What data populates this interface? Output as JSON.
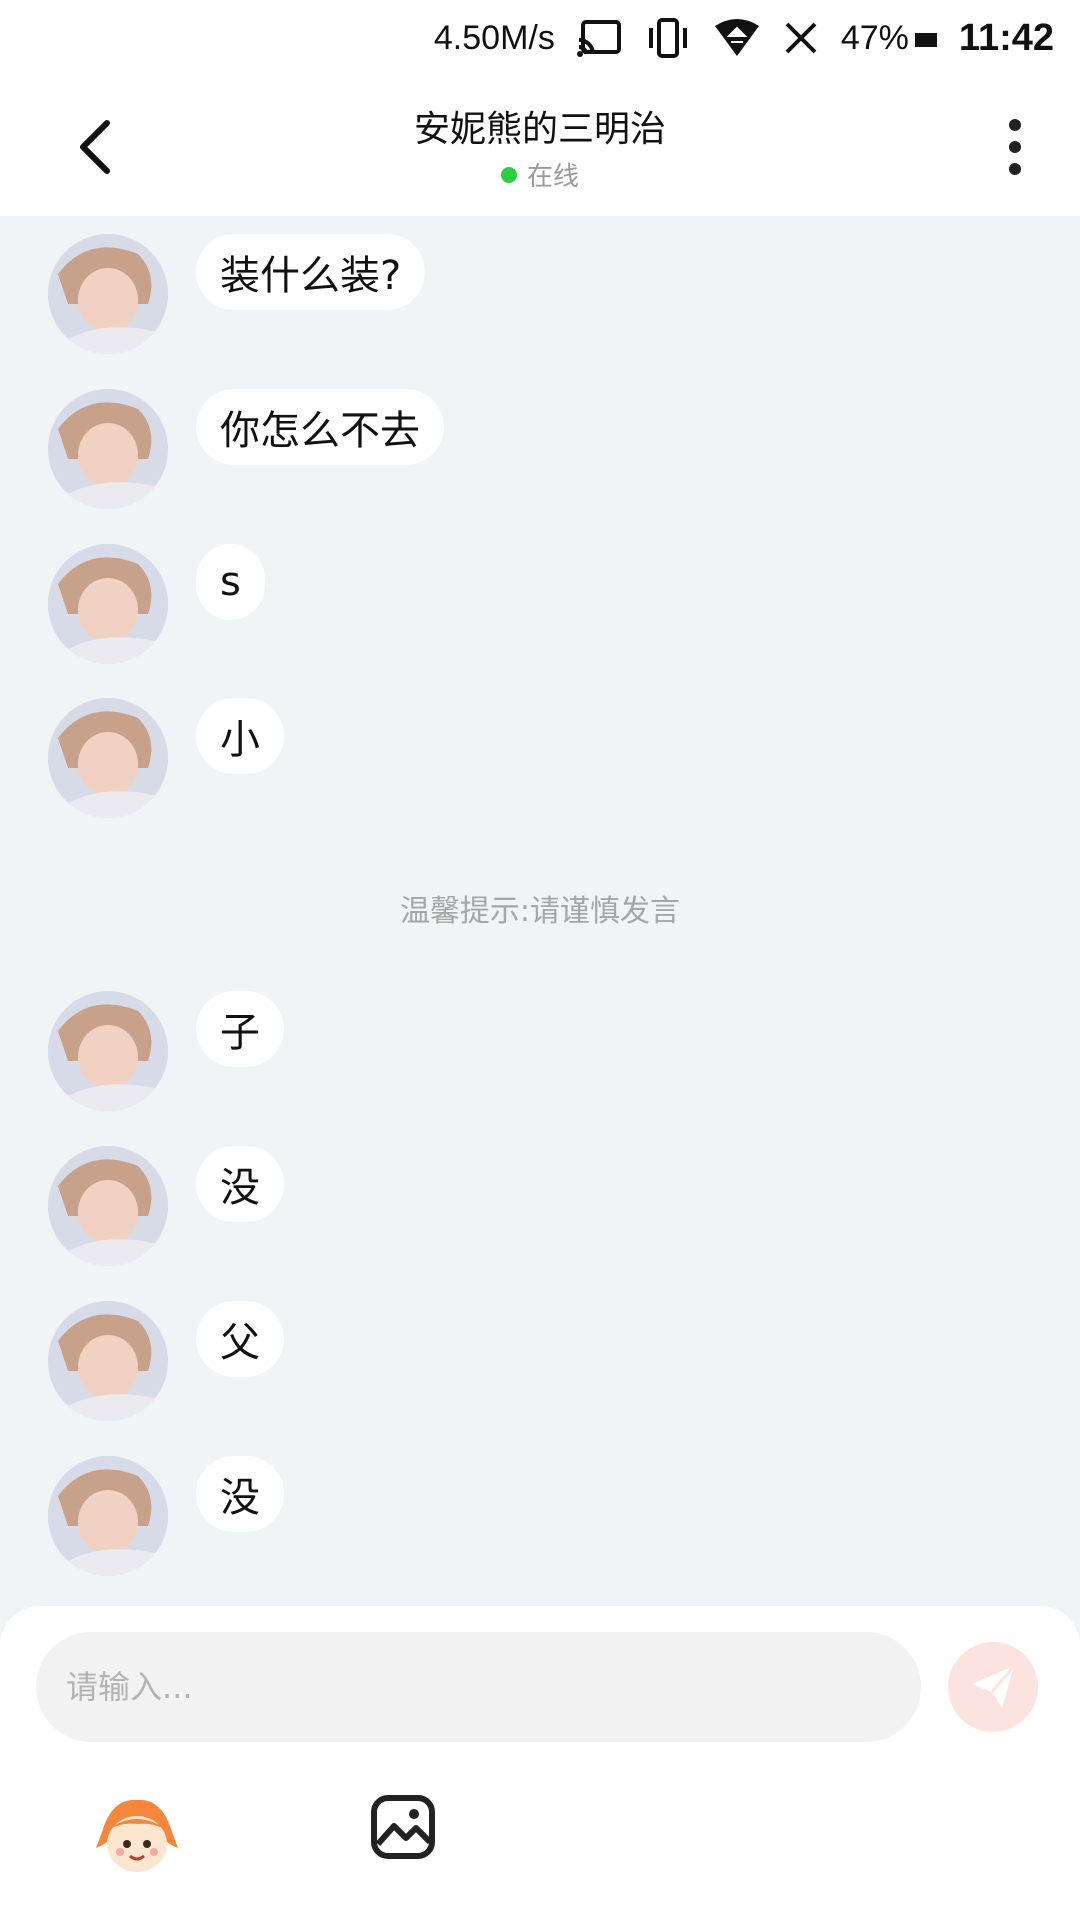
{
  "status_bar": {
    "speed": "4.50M/s",
    "battery": "47%",
    "time": "11:42"
  },
  "header": {
    "title": "安妮熊的三明治",
    "status": "在线"
  },
  "messages": [
    {
      "text": "装什么装?"
    },
    {
      "text": "你怎么不去"
    },
    {
      "text": "s"
    },
    {
      "text": "小"
    },
    {
      "text": "子"
    },
    {
      "text": "没"
    },
    {
      "text": "父"
    },
    {
      "text": "没"
    }
  ],
  "hint": "温馨提示:请谨慎发言",
  "composer": {
    "placeholder": "请输入..."
  },
  "colors": {
    "online": "#2ecc40",
    "send_button": "#fde3e0",
    "chat_background": "#f0f4f6"
  },
  "icons": [
    "back-arrow-icon",
    "more-dots-icon",
    "send-icon",
    "emoji-mascot-icon",
    "image-icon",
    "cast-icon",
    "vibrate-icon",
    "wifi-icon",
    "no-signal-icon"
  ]
}
